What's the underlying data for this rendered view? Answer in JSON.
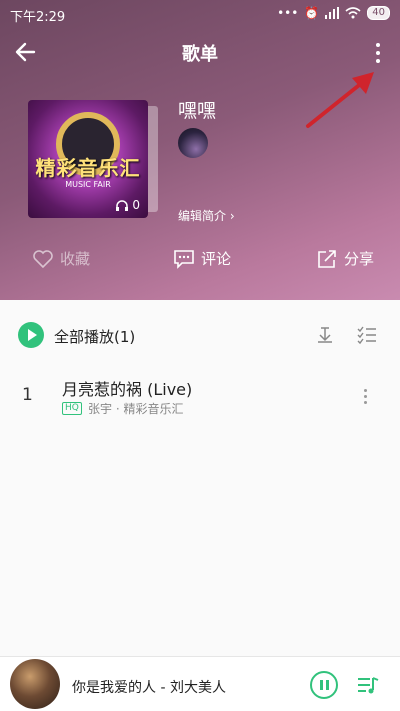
{
  "status_bar": {
    "time": "下午2:29",
    "battery": "40"
  },
  "header": {
    "title": "歌单"
  },
  "playlist": {
    "name": "嘿嘿",
    "cover_text": "精彩音乐汇",
    "cover_subtext": "MUSIC FAIR",
    "play_count": "0",
    "edit_intro_label": "编辑简介 ›"
  },
  "actions": {
    "favorite_label": "收藏",
    "comment_label": "评论",
    "share_label": "分享"
  },
  "list": {
    "play_all_label": "全部播放(1)",
    "songs": [
      {
        "index": "1",
        "title": "月亮惹的祸 (Live)",
        "badge": "HQ",
        "meta": "张宇 · 精彩音乐汇"
      }
    ]
  },
  "mini_player": {
    "title": "你是我爱的人 - 刘大美人"
  },
  "colors": {
    "accent": "#31c27c",
    "annotation": "#d0242c"
  }
}
